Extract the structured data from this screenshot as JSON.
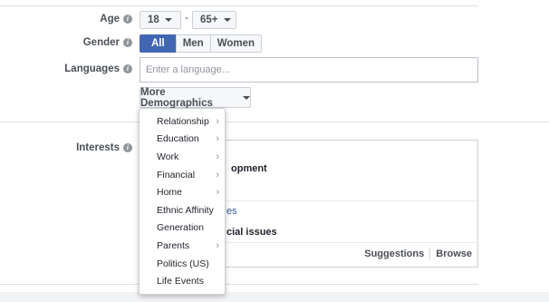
{
  "age": {
    "label": "Age",
    "min": "18",
    "max": "65+",
    "separator": "-"
  },
  "gender": {
    "label": "Gender",
    "options": [
      "All",
      "Men",
      "Women"
    ],
    "selected": "All"
  },
  "languages": {
    "label": "Languages",
    "placeholder": "Enter a language...",
    "value": ""
  },
  "more_demographics": {
    "label": "More Demographics"
  },
  "interests": {
    "label": "Interests",
    "visible_fragments": [
      "opment",
      "es",
      "cial issues"
    ],
    "actions": [
      "Suggestions",
      "Browse"
    ]
  },
  "dropdown": {
    "items": [
      {
        "label": "Relationship",
        "has_submenu": true
      },
      {
        "label": "Education",
        "has_submenu": true
      },
      {
        "label": "Work",
        "has_submenu": true
      },
      {
        "label": "Financial",
        "has_submenu": true
      },
      {
        "label": "Home",
        "has_submenu": true
      },
      {
        "label": "Ethnic Affinity",
        "has_submenu": false
      },
      {
        "label": "Generation",
        "has_submenu": false
      },
      {
        "label": "Parents",
        "has_submenu": true
      },
      {
        "label": "Politics (US)",
        "has_submenu": false
      },
      {
        "label": "Life Events",
        "has_submenu": false
      }
    ]
  },
  "colors": {
    "accent": "#4267b2",
    "link": "#365899",
    "border": "#ccd0d5"
  }
}
